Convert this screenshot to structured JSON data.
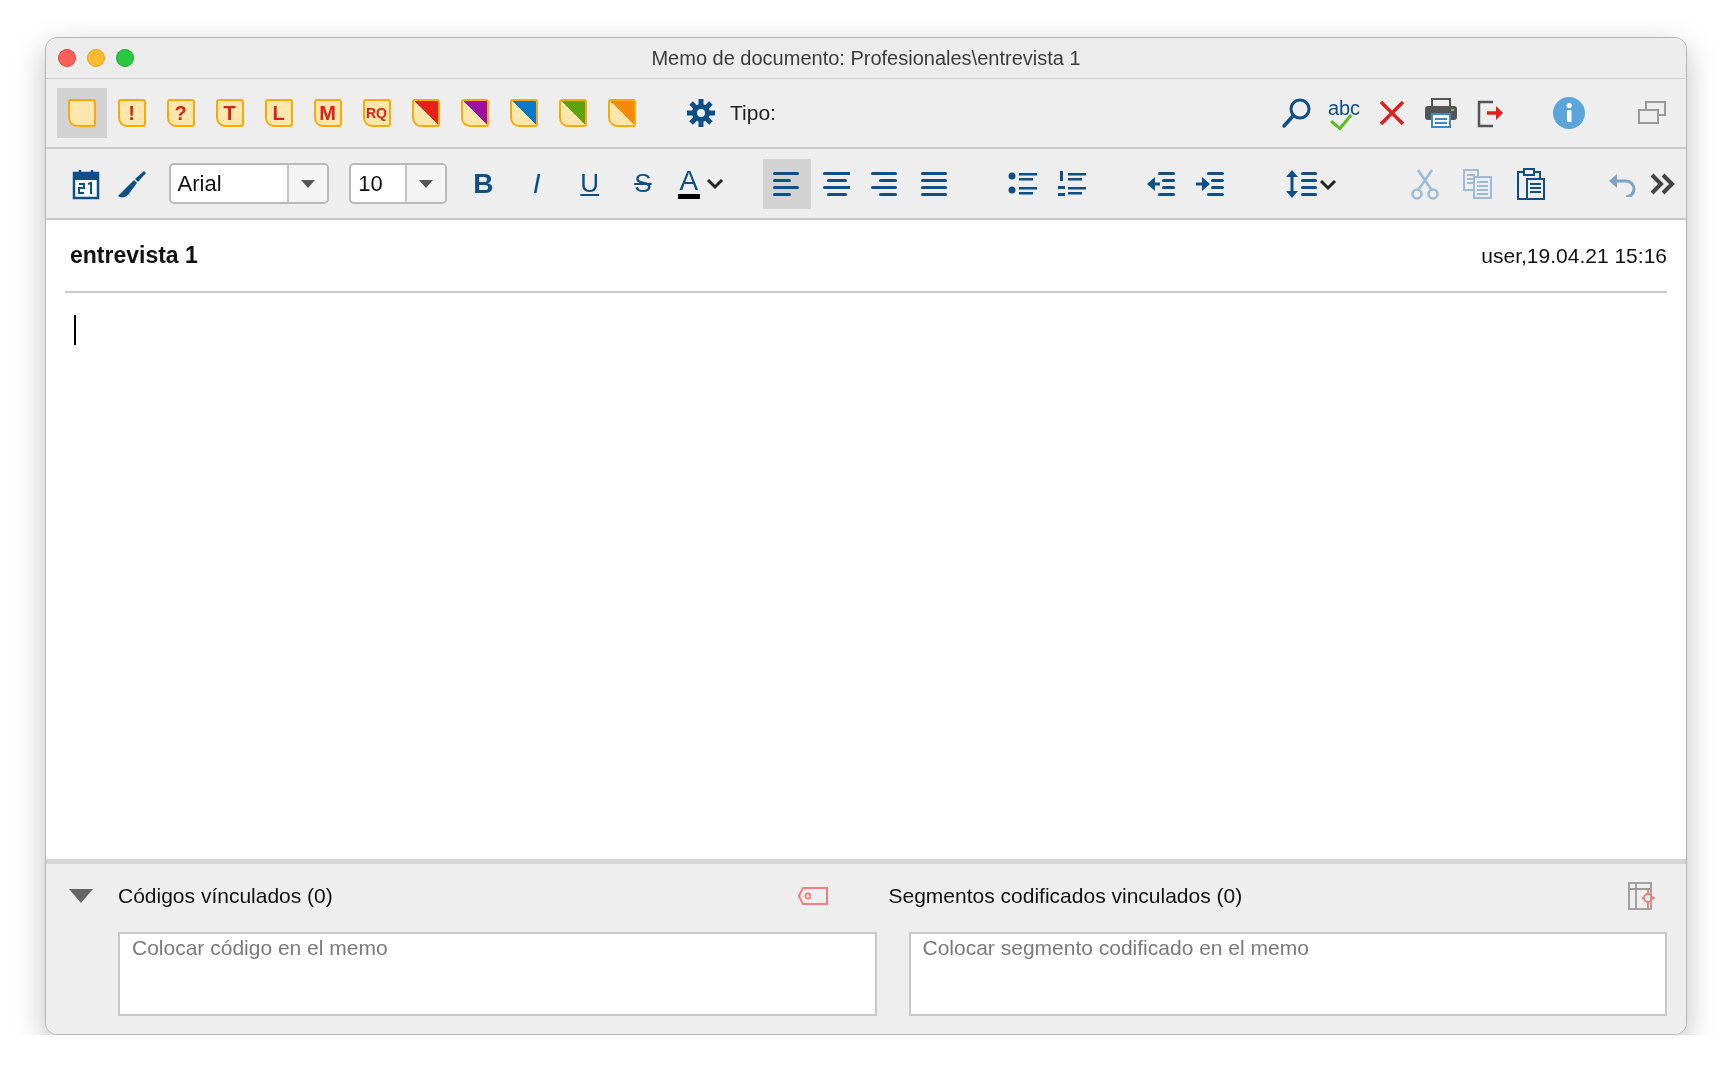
{
  "window": {
    "title": "Memo de documento: Profesionales\\entrevista 1"
  },
  "memo_types": [
    {
      "kind": "plain",
      "selected": true
    },
    {
      "kind": "letter",
      "letter": "!",
      "selected": false
    },
    {
      "kind": "letter",
      "letter": "?",
      "selected": false
    },
    {
      "kind": "letter",
      "letter": "T",
      "selected": false
    },
    {
      "kind": "letter",
      "letter": "L",
      "selected": false
    },
    {
      "kind": "letter",
      "letter": "M",
      "selected": false
    },
    {
      "kind": "letter",
      "letter": "RQ",
      "selected": false
    },
    {
      "kind": "corner",
      "color": "#e2231a",
      "selected": false
    },
    {
      "kind": "corner",
      "color": "#9c0f9f",
      "selected": false
    },
    {
      "kind": "corner",
      "color": "#0a78c8",
      "selected": false
    },
    {
      "kind": "corner",
      "color": "#5ca30f",
      "selected": false
    },
    {
      "kind": "corner",
      "color": "#f58a07",
      "selected": false
    }
  ],
  "type_label": "Tipo:",
  "spellcheck_label": "abc",
  "font": {
    "value": "Arial"
  },
  "font_size": {
    "value": "10"
  },
  "format_buttons": [
    {
      "kind": "bold",
      "label": "B"
    },
    {
      "kind": "italic",
      "label": "I"
    },
    {
      "kind": "underline",
      "label": "U"
    },
    {
      "kind": "strike",
      "label": "S"
    }
  ],
  "text_color_label": "A",
  "align_buttons": [
    {
      "kind": "left",
      "selected": true
    },
    {
      "kind": "center",
      "selected": false
    },
    {
      "kind": "right",
      "selected": false
    },
    {
      "kind": "justify",
      "selected": false
    }
  ],
  "memo": {
    "title": "entrevista 1",
    "meta": "user,19.04.21 15:16"
  },
  "links": {
    "expanded": true,
    "codes": {
      "title": "Códigos vínculados (0)",
      "placeholder": "Colocar código en el memo"
    },
    "segments": {
      "title": "Segmentos codificados vinculados (0)",
      "placeholder": "Colocar segmento codificado en el memo"
    }
  }
}
